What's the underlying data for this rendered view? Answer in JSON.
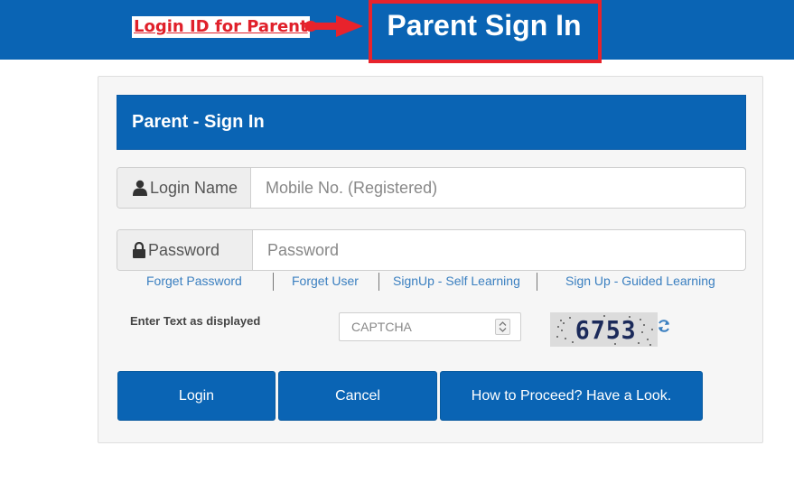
{
  "annotation": {
    "link_text": "Login ID for Parent",
    "highlighted_title": "Parent Sign In",
    "highlight_color": "#e8232c"
  },
  "panel": {
    "title": "Parent - Sign In",
    "login_name": {
      "label": "Login Name",
      "placeholder": "Mobile No. (Registered)",
      "icon": "user-icon"
    },
    "password": {
      "label": "Password",
      "placeholder": "Password",
      "icon": "lock-icon"
    },
    "links": [
      "Forget Password",
      "Forget User",
      "SignUp - Self Learning",
      "Sign Up - Guided Learning"
    ],
    "captcha": {
      "label": "Enter Text as displayed",
      "placeholder": "CAPTCHA",
      "image_text": "6753",
      "refresh_icon": "refresh-icon"
    },
    "buttons": {
      "login": "Login",
      "cancel": "Cancel",
      "how_to": "How to Proceed? Have a Look."
    }
  },
  "colors": {
    "brand_blue": "#0a64b4",
    "link_blue": "#3a7fc0",
    "annotation_red": "#e8232c"
  }
}
